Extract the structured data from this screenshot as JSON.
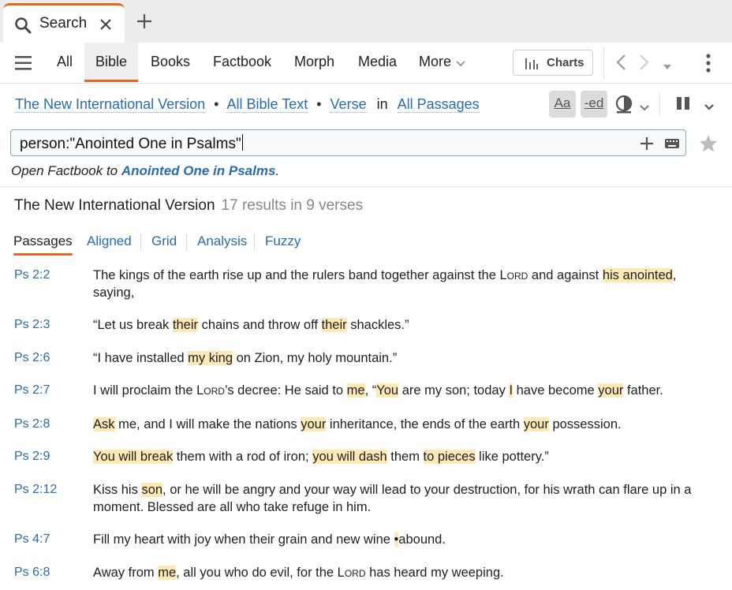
{
  "tab": {
    "label": "Search"
  },
  "toolbar": {
    "nav": [
      "All",
      "Bible",
      "Books",
      "Factbook",
      "Morph",
      "Media",
      "More"
    ],
    "active_nav": "Bible",
    "charts_label": "Charts"
  },
  "query": {
    "version": "The New International Version",
    "scope": "All Bible Text",
    "unit": "Verse",
    "in_word": "in",
    "range": "All Passages",
    "case_btn": "Aa",
    "ending_btn": "-ed"
  },
  "search": {
    "value": "person:\"Anointed One in Psalms\""
  },
  "factbook": {
    "prefix": "Open Factbook to ",
    "link": "Anointed One in Psalms",
    "suffix": "."
  },
  "results": {
    "title": "The New International Version",
    "count": "17 results in 9 verses",
    "tabs": [
      "Passages",
      "Aligned",
      "Grid",
      "Analysis",
      "Fuzzy"
    ]
  },
  "verses": [
    {
      "ref": "Ps 2:2",
      "segments": [
        {
          "t": "The kings of the earth rise up and the rulers band together against the "
        },
        {
          "t": "Lord",
          "sc": true
        },
        {
          "t": " and against "
        },
        {
          "t": "his anointed",
          "hl": true
        },
        {
          "t": ", saying,"
        }
      ]
    },
    {
      "ref": "Ps 2:3",
      "segments": [
        {
          "t": "“Let us break "
        },
        {
          "t": "their",
          "hl": true
        },
        {
          "t": " chains and throw off "
        },
        {
          "t": "their",
          "hl": true
        },
        {
          "t": " shackles.”"
        }
      ]
    },
    {
      "ref": "Ps 2:6",
      "segments": [
        {
          "t": "“I have installed "
        },
        {
          "t": "my king",
          "hl": true
        },
        {
          "t": " on Zion, my holy mountain.”"
        }
      ]
    },
    {
      "ref": "Ps 2:7",
      "segments": [
        {
          "t": "I will proclaim the "
        },
        {
          "t": "Lord",
          "sc": true
        },
        {
          "t": "’s decree: He said to "
        },
        {
          "t": "me",
          "hl": true
        },
        {
          "t": ", “"
        },
        {
          "t": "You",
          "hl": true
        },
        {
          "t": " are my son; today "
        },
        {
          "t": "I",
          "hl": true
        },
        {
          "t": " have become "
        },
        {
          "t": "your",
          "hl": true
        },
        {
          "t": " father."
        }
      ]
    },
    {
      "ref": "Ps 2:8",
      "segments": [
        {
          "t": "Ask",
          "hl": true
        },
        {
          "t": " me, and I will make the nations "
        },
        {
          "t": "your",
          "hl": true
        },
        {
          "t": " inheritance, the ends of the earth "
        },
        {
          "t": "your",
          "hl": true
        },
        {
          "t": " possession."
        }
      ]
    },
    {
      "ref": "Ps 2:9",
      "segments": [
        {
          "t": "You will break",
          "hl": true
        },
        {
          "t": " them with a rod of iron; "
        },
        {
          "t": "you will dash",
          "hl": true
        },
        {
          "t": " them "
        },
        {
          "t": "to pieces",
          "hl": true
        },
        {
          "t": " like pottery.”"
        }
      ]
    },
    {
      "ref": "Ps 2:12",
      "segments": [
        {
          "t": "Kiss his "
        },
        {
          "t": "son",
          "hl": true
        },
        {
          "t": ", or he will be angry and your way will lead to your destruction, for his wrath can flare up in a moment. Blessed are all who take refuge in him."
        }
      ]
    },
    {
      "ref": "Ps 4:7",
      "segments": [
        {
          "t": "Fill my heart with joy when their grain and new wine "
        },
        {
          "t": "•",
          "hl": true
        },
        {
          "t": "abound."
        }
      ]
    },
    {
      "ref": "Ps 6:8",
      "segments": [
        {
          "t": "Away from "
        },
        {
          "t": "me",
          "hl": true
        },
        {
          "t": ", all you who do evil, for the "
        },
        {
          "t": "Lord",
          "sc": true
        },
        {
          "t": " has heard my weeping."
        }
      ]
    }
  ]
}
